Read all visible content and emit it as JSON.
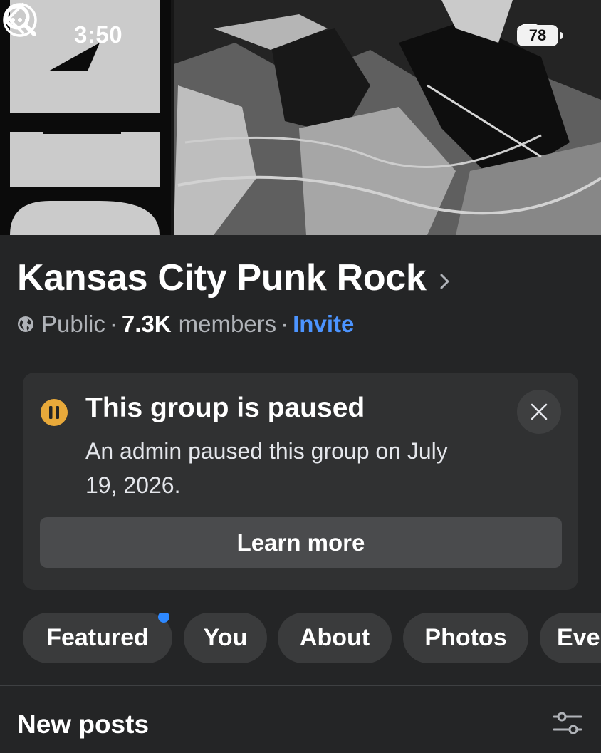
{
  "status_bar": {
    "time": "3:50",
    "battery": "78"
  },
  "group": {
    "title": "Kansas City Punk Rock",
    "privacy": "Public",
    "separator": "·",
    "members_count": "7.3K",
    "members_label": "members",
    "invite": "Invite"
  },
  "paused_notice": {
    "title": "This group is paused",
    "description": "An admin paused this group on July 19, 2026.",
    "button": "Learn more",
    "accent_color": "#e8a93a"
  },
  "tabs": [
    {
      "label": "Featured",
      "has_badge": true
    },
    {
      "label": "You"
    },
    {
      "label": "About"
    },
    {
      "label": "Photos"
    },
    {
      "label": "Eve"
    }
  ],
  "feed": {
    "section_title": "New posts"
  },
  "icons": [
    "back-icon",
    "search-icon",
    "more-icon",
    "globe-icon",
    "pause-icon",
    "close-icon",
    "filter-icon",
    "chevron-right-icon"
  ]
}
